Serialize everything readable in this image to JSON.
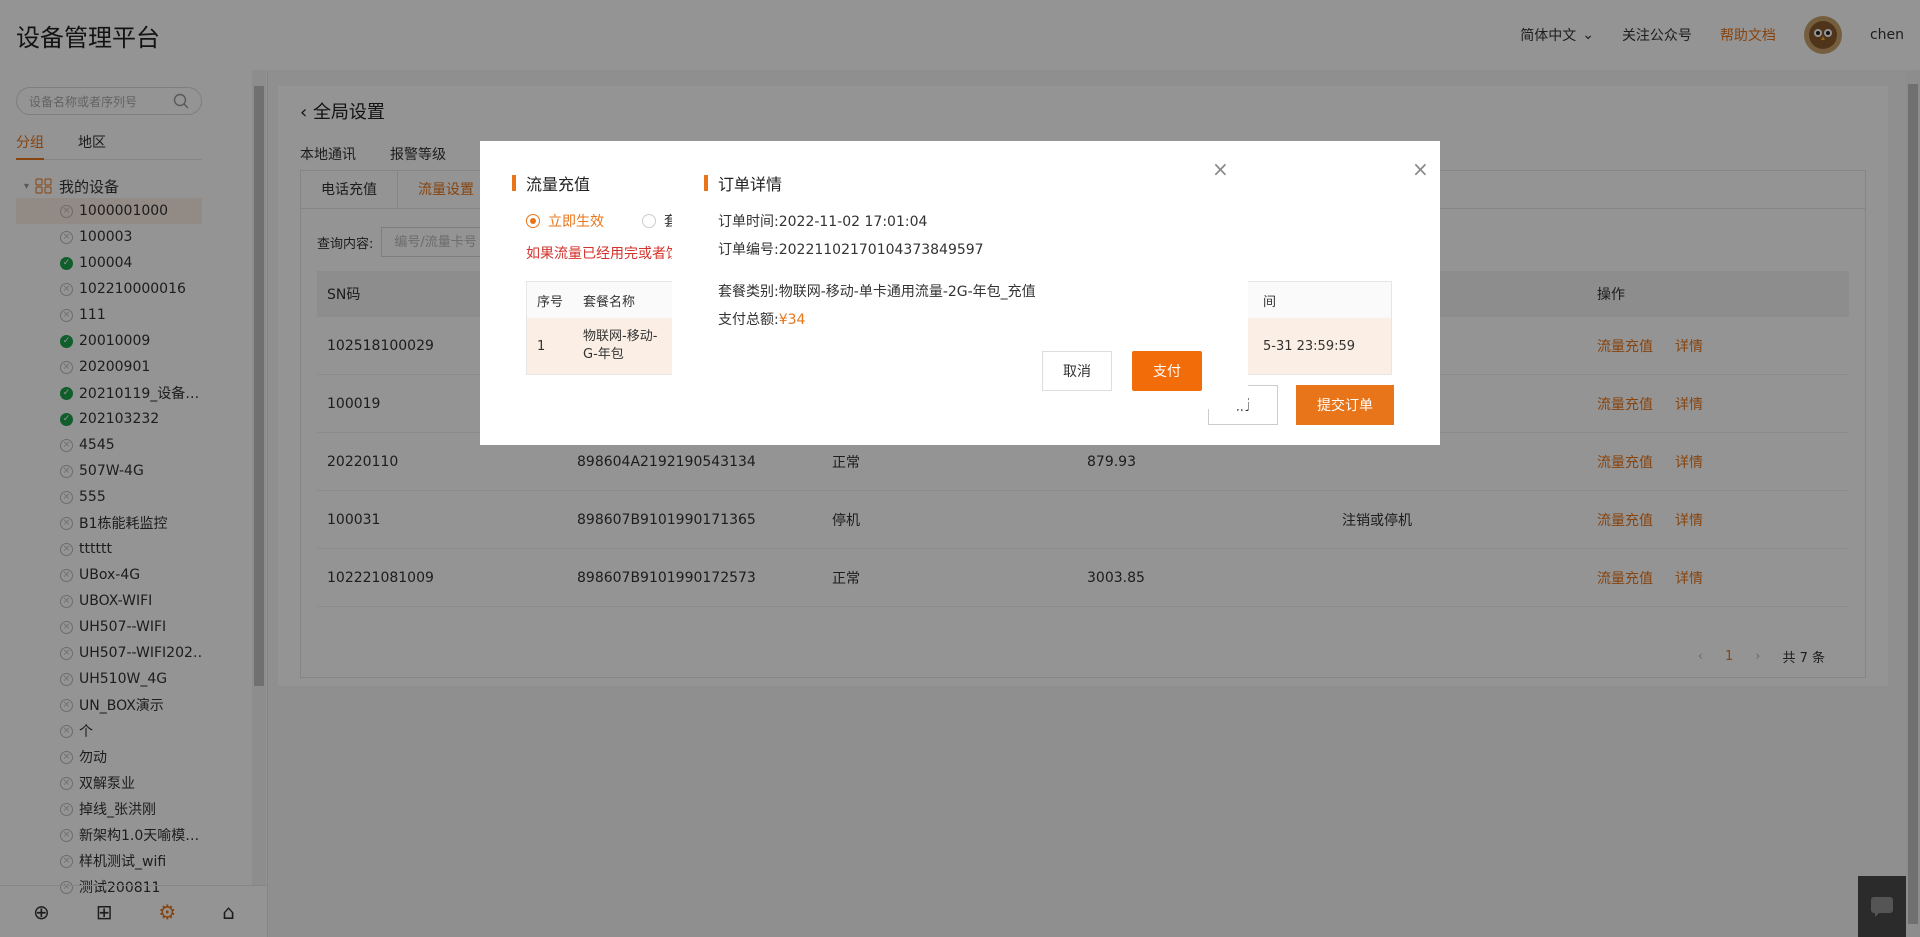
{
  "header": {
    "title": "设备管理平台",
    "language": "简体中文",
    "follow": "关注公众号",
    "help": "帮助文档",
    "username": "chen"
  },
  "sidebar": {
    "search_placeholder": "设备名称或者序列号",
    "tabs": [
      "分组",
      "地区"
    ],
    "root": "我的设备",
    "devices": [
      {
        "name": "1000001000",
        "online": false
      },
      {
        "name": "100003",
        "online": false
      },
      {
        "name": "100004",
        "online": true
      },
      {
        "name": "102210000016",
        "online": false
      },
      {
        "name": "111",
        "online": false
      },
      {
        "name": "20010009",
        "online": true
      },
      {
        "name": "20200901",
        "online": false
      },
      {
        "name": "20210119_设备…",
        "online": true
      },
      {
        "name": "202103232",
        "online": true
      },
      {
        "name": "4545",
        "online": false
      },
      {
        "name": "507W-4G",
        "online": false
      },
      {
        "name": "555",
        "online": false
      },
      {
        "name": "B1栋能耗监控",
        "online": false
      },
      {
        "name": "tttttt",
        "online": false
      },
      {
        "name": "UBox-4G",
        "online": false
      },
      {
        "name": "UBOX-WIFI",
        "online": false
      },
      {
        "name": "UH507--WIFI",
        "online": false
      },
      {
        "name": "UH507--WIFI202…",
        "online": false
      },
      {
        "name": "UH510W_4G",
        "online": false
      },
      {
        "name": "UN_BOX演示",
        "online": false
      },
      {
        "name": "个",
        "online": false
      },
      {
        "name": "勿动",
        "online": false
      },
      {
        "name": "双解泵业",
        "online": false
      },
      {
        "name": "掉线_张洪刚",
        "online": false
      },
      {
        "name": "新架构1.0天喻模…",
        "online": false
      },
      {
        "name": "样机测试_wifi",
        "online": false
      },
      {
        "name": "测试200811",
        "online": false
      }
    ]
  },
  "main": {
    "page_title": "全局设置",
    "subtabs": [
      "本地通讯",
      "报警等级"
    ],
    "card_tabs": [
      "电话充值",
      "流量设置"
    ],
    "query_label": "查询内容:",
    "query_placeholder": "编号/流量卡号",
    "columns": [
      "SN码",
      "",
      "",
      "",
      "",
      "操作"
    ],
    "rows": [
      {
        "sn": "102518100029",
        "iccid": "",
        "status": "",
        "flow": "",
        "note": ""
      },
      {
        "sn": "100019",
        "iccid": "",
        "status": "",
        "flow": "",
        "note": ""
      },
      {
        "sn": "20220110",
        "iccid": "898604A2192190543134",
        "status": "正常",
        "flow": "879.93",
        "note": ""
      },
      {
        "sn": "100031",
        "iccid": "898607B9101990171365",
        "status": "停机",
        "flow": "",
        "note": "注销或停机"
      },
      {
        "sn": "102221081009",
        "iccid": "898607B9101990172573",
        "status": "正常",
        "flow": "3003.85",
        "note": ""
      }
    ],
    "action_recharge": "流量充值",
    "action_detail": "详情",
    "pager_current": "1",
    "pager_total": "共 7 条"
  },
  "recharge_dialog": {
    "title": "流量充值",
    "radio1": "立即生效",
    "radio2": "套",
    "warning": "如果流量已经用完或者饮",
    "col_index": "序号",
    "col_name": "套餐名称",
    "col_time": "间",
    "row_index": "1",
    "row_name_l1": "物联网-移动-",
    "row_name_l2": "G-年包",
    "row_time": "5-31 23:59:59",
    "cancel_partial": "消",
    "submit": "提交订单"
  },
  "order_dialog": {
    "title": "订单详情",
    "time": "订单时间:2022-11-02 17:01:04",
    "number": "订单编号:20221102170104373849597",
    "category": "套餐类别:物联网-移动-单卡通用流量-2G-年包_充值",
    "total_label": "支付总额:",
    "total_value": "¥34",
    "cancel": "取消",
    "pay": "支付"
  },
  "colors": {
    "accent": "#e8751a",
    "online": "#1aa34a",
    "warning": "#d4322c"
  }
}
